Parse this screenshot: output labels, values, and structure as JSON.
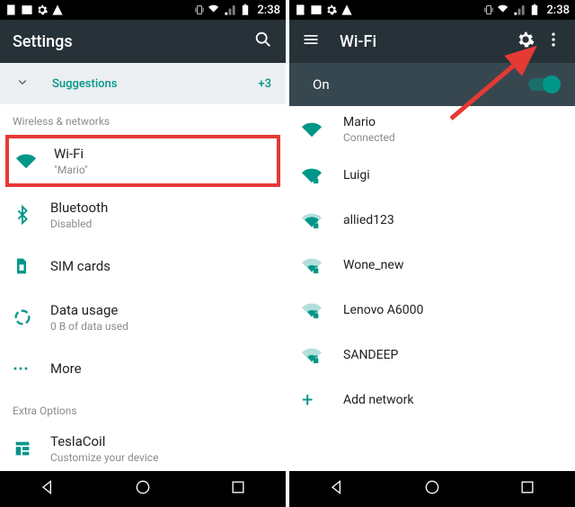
{
  "status": {
    "time": "2:38"
  },
  "left": {
    "appbar_title": "Settings",
    "suggestions_label": "Suggestions",
    "suggestions_count": "+3",
    "section_wireless": "Wireless & networks",
    "wifi": {
      "title": "Wi-Fi",
      "sub": "\"Mario\""
    },
    "bt": {
      "title": "Bluetooth",
      "sub": "Disabled"
    },
    "sim": {
      "title": "SIM cards"
    },
    "data": {
      "title": "Data usage",
      "sub": "0 B of data used"
    },
    "more": {
      "title": "More"
    },
    "section_extra": "Extra Options",
    "tesla": {
      "title": "TeslaCoil",
      "sub": "Customize your device"
    }
  },
  "right": {
    "appbar_title": "Wi-Fi",
    "on_label": "On",
    "nets": [
      {
        "title": "Mario",
        "sub": "Connected",
        "secure": false,
        "strength": 4
      },
      {
        "title": "Luigi",
        "secure": true,
        "strength": 4
      },
      {
        "title": "allied123",
        "secure": true,
        "strength": 3
      },
      {
        "title": "Wone_new",
        "secure": true,
        "strength": 2
      },
      {
        "title": "Lenovo A6000",
        "secure": true,
        "strength": 2
      },
      {
        "title": "SANDEEP",
        "secure": true,
        "strength": 2
      }
    ],
    "add_network": "Add network"
  }
}
